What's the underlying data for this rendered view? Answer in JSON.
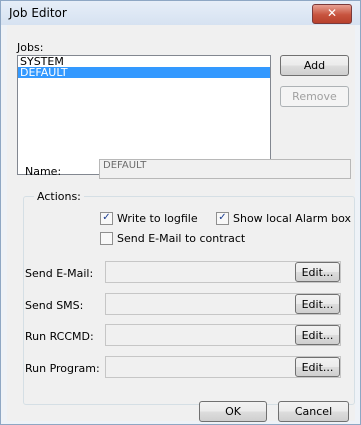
{
  "window": {
    "title": "Job Editor",
    "close_glyph": "✕"
  },
  "jobs": {
    "label": "Jobs:",
    "items": [
      {
        "label": "SYSTEM",
        "selected": false
      },
      {
        "label": "DEFAULT",
        "selected": true
      }
    ]
  },
  "buttons": {
    "add": "Add",
    "remove": "Remove",
    "ok": "OK",
    "cancel": "Cancel"
  },
  "name": {
    "label": "Name:",
    "value": "DEFAULT"
  },
  "actions": {
    "title": "Actions:",
    "checkboxes": [
      {
        "label": "Write to logfile",
        "checked": true
      },
      {
        "label": "Show local Alarm box",
        "checked": true
      },
      {
        "label": "Send E-Mail to contract",
        "checked": false
      }
    ],
    "rows": [
      {
        "label": "Send E-Mail:",
        "value": "",
        "button": "Edit..."
      },
      {
        "label": "Send SMS:",
        "value": "",
        "button": "Edit..."
      },
      {
        "label": "Run RCCMD:",
        "value": "",
        "button": "Edit..."
      },
      {
        "label": "Run Program:",
        "value": "",
        "button": "Edit..."
      }
    ]
  },
  "colors": {
    "selection": "#3399ff",
    "close_button": "#c7533e"
  }
}
